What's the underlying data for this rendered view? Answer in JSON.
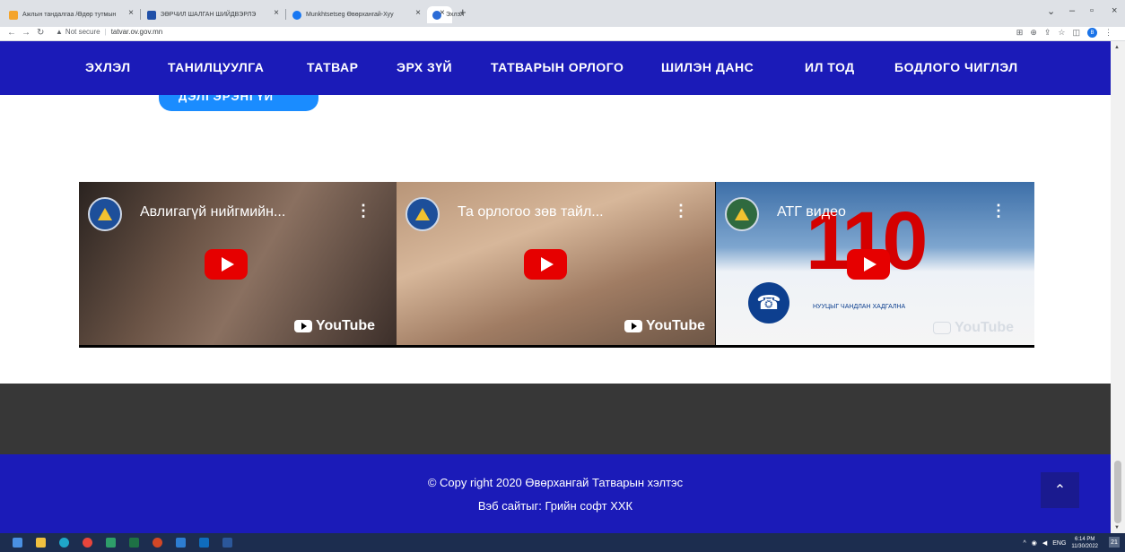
{
  "browser": {
    "tabs": [
      {
        "title": "Ажлын тандалгаа /Өдөр тутмын",
        "fav_color": "#f4a42c"
      },
      {
        "title": "ЗӨРЧИЛ ШАЛГАН ШИЙДВЭРЛЭ",
        "fav_color": "#2050a8"
      },
      {
        "title": "Munkhtsetseg Өвөрхангай-Хуу",
        "fav_color": "#1877f2"
      },
      {
        "title": "Эхлэл",
        "fav_color": "#2a6bd6"
      }
    ],
    "url_security": "Not secure",
    "url": "tatvar.ov.gov.mn",
    "profile_initial": "B"
  },
  "nav": {
    "items": [
      "ЭХЛЭЛ",
      "ТАНИЛЦУУЛГА",
      "ТАТВАР",
      "ЭРХ ЗҮЙ",
      "ТАТВАРЫН ОРЛОГО",
      "ШИЛЭН ДАНС",
      "ИЛ ТОД",
      "БОДЛОГО ЧИГЛЭЛ"
    ]
  },
  "hero_button": {
    "label": "ДЭЛГЭРЭНГҮЙ"
  },
  "videos": [
    {
      "title": "Авлигагүй нийгмийн...",
      "brand": "YouTube"
    },
    {
      "title": "Та орлогоо зөв тайл...",
      "brand": "YouTube"
    },
    {
      "title": "АТГ видео",
      "brand": "YouTube",
      "big_number": "110",
      "hotline": "НУУЦЫГ ЧАНДЛАН ХАДГАЛНА"
    }
  ],
  "footer": {
    "copyright": "© Copy right 2020 Өвөрхангай Татварын хэлтэс",
    "website": "Вэб сайтыг: Грийн софт ХХК",
    "to_top_icon": "chevron-up-icon"
  },
  "taskbar": {
    "lang": "ENG",
    "time": "6:14 PM",
    "date": "11/30/2022",
    "notifications": "21"
  },
  "colors": {
    "nav_bg": "#1b1bb8",
    "pill": "#1a8cff",
    "dark_band": "#373737"
  }
}
